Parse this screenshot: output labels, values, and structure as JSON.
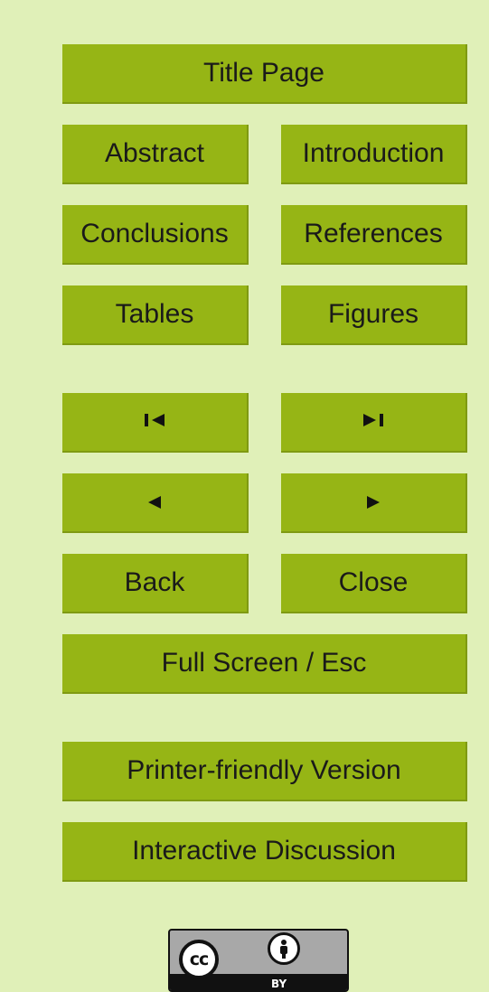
{
  "nav": {
    "title_page": "Title Page",
    "abstract": "Abstract",
    "introduction": "Introduction",
    "conclusions": "Conclusions",
    "references": "References",
    "tables": "Tables",
    "figures": "Figures",
    "first": "◀",
    "last": "▶",
    "prev": "◀",
    "next": "▶",
    "back": "Back",
    "close": "Close",
    "full_screen": "Full Screen / Esc",
    "printer_friendly": "Printer-friendly Version",
    "interactive_discussion": "Interactive Discussion"
  },
  "license": {
    "cc_label": "cc",
    "by_label": "BY",
    "icon": "creative-commons-by-icon"
  },
  "colors": {
    "background": "#e0f0b8",
    "button": "#96b515"
  }
}
